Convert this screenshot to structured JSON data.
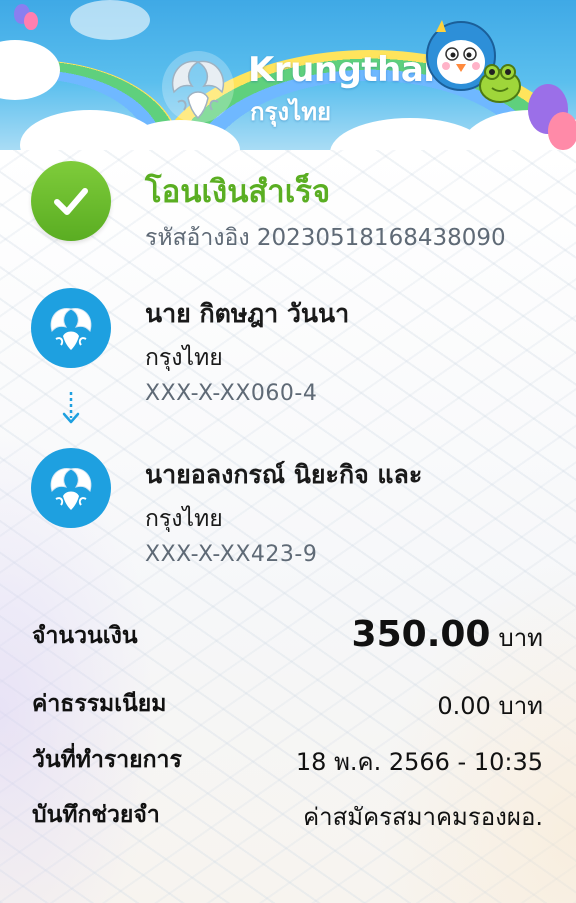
{
  "header": {
    "brand_en": "Krungthai",
    "brand_th": "กรุงไทย"
  },
  "status": {
    "title": "โอนเงินสำเร็จ",
    "reference": "รหัสอ้างอิง 20230518168438090",
    "color": "#5aae22"
  },
  "sender": {
    "name": "นาย กิตษฎา วันนา",
    "bank": "กรุงไทย",
    "account": "XXX-X-XX060-4"
  },
  "receiver": {
    "name": "นายอลงกรณ์ นิยะกิจ และ",
    "bank": "กรุงไทย",
    "account": "XXX-X-XX423-9"
  },
  "details": {
    "amount_label": "จำนวนเงิน",
    "amount_value": "350.00",
    "amount_unit": "บาท",
    "fee_label": "ค่าธรรมเนียม",
    "fee_value": "0.00 บาท",
    "date_label": "วันที่ทำรายการ",
    "date_value": "18 พ.ค. 2566 - 10:35",
    "memo_label": "บันทึกช่วยจำ",
    "memo_value": "ค่าสมัครสมาคมรองผอ."
  },
  "icons": {
    "success": "check-icon",
    "bank_logo": "krungthai-bird-icon",
    "transfer_direction": "arrow-down-icon"
  },
  "colors": {
    "brand_blue": "#1ea0e0",
    "success_green": "#5aae22",
    "muted_text": "#5f6a76"
  }
}
